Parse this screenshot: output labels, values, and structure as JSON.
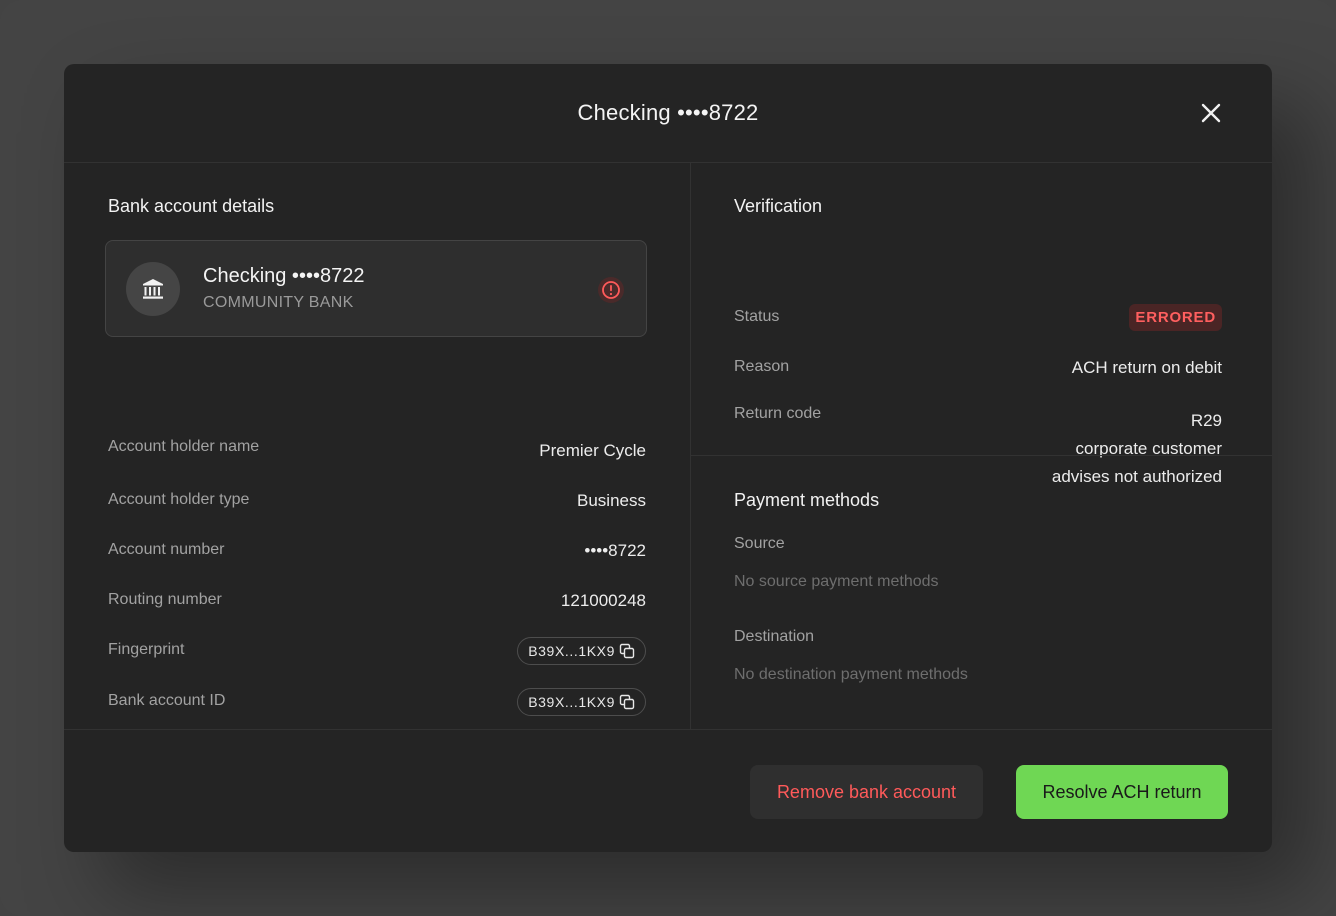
{
  "modal": {
    "title": "Checking ••••8722"
  },
  "account_details": {
    "section_title": "Bank account details",
    "card": {
      "name": "Checking ••••8722",
      "bank": "COMMUNITY BANK",
      "icon": "bank-icon",
      "status_icon": "alert-circle-icon"
    },
    "rows": [
      {
        "label": "Account holder name",
        "value": "Premier Cycle"
      },
      {
        "label": "Account holder type",
        "value": "Business"
      },
      {
        "label": "Account number",
        "value": "••••8722"
      },
      {
        "label": "Routing number",
        "value": "121000248"
      }
    ],
    "fingerprint": {
      "label": "Fingerprint",
      "value": "B39X...1KX9"
    },
    "bank_account_id": {
      "label": "Bank account ID",
      "value": "B39X...1KX9"
    }
  },
  "verification": {
    "section_title": "Verification",
    "status_label": "Status",
    "status_value": "ERRORED",
    "reason_label": "Reason",
    "reason_value": "ACH return on debit",
    "return_code_label": "Return code",
    "return_code_lines": [
      "R29",
      "corporate customer",
      "advises not authorized"
    ]
  },
  "payment_methods": {
    "section_title": "Payment methods",
    "source_label": "Source",
    "source_empty": "No source payment methods",
    "destination_label": "Destination",
    "destination_empty": "No destination payment methods"
  },
  "footer": {
    "remove_label": "Remove bank account",
    "resolve_label": "Resolve ACH return"
  },
  "colors": {
    "background": "#434343",
    "modal": "#242424",
    "error": "#ff5a5a",
    "success": "#6fd754"
  }
}
